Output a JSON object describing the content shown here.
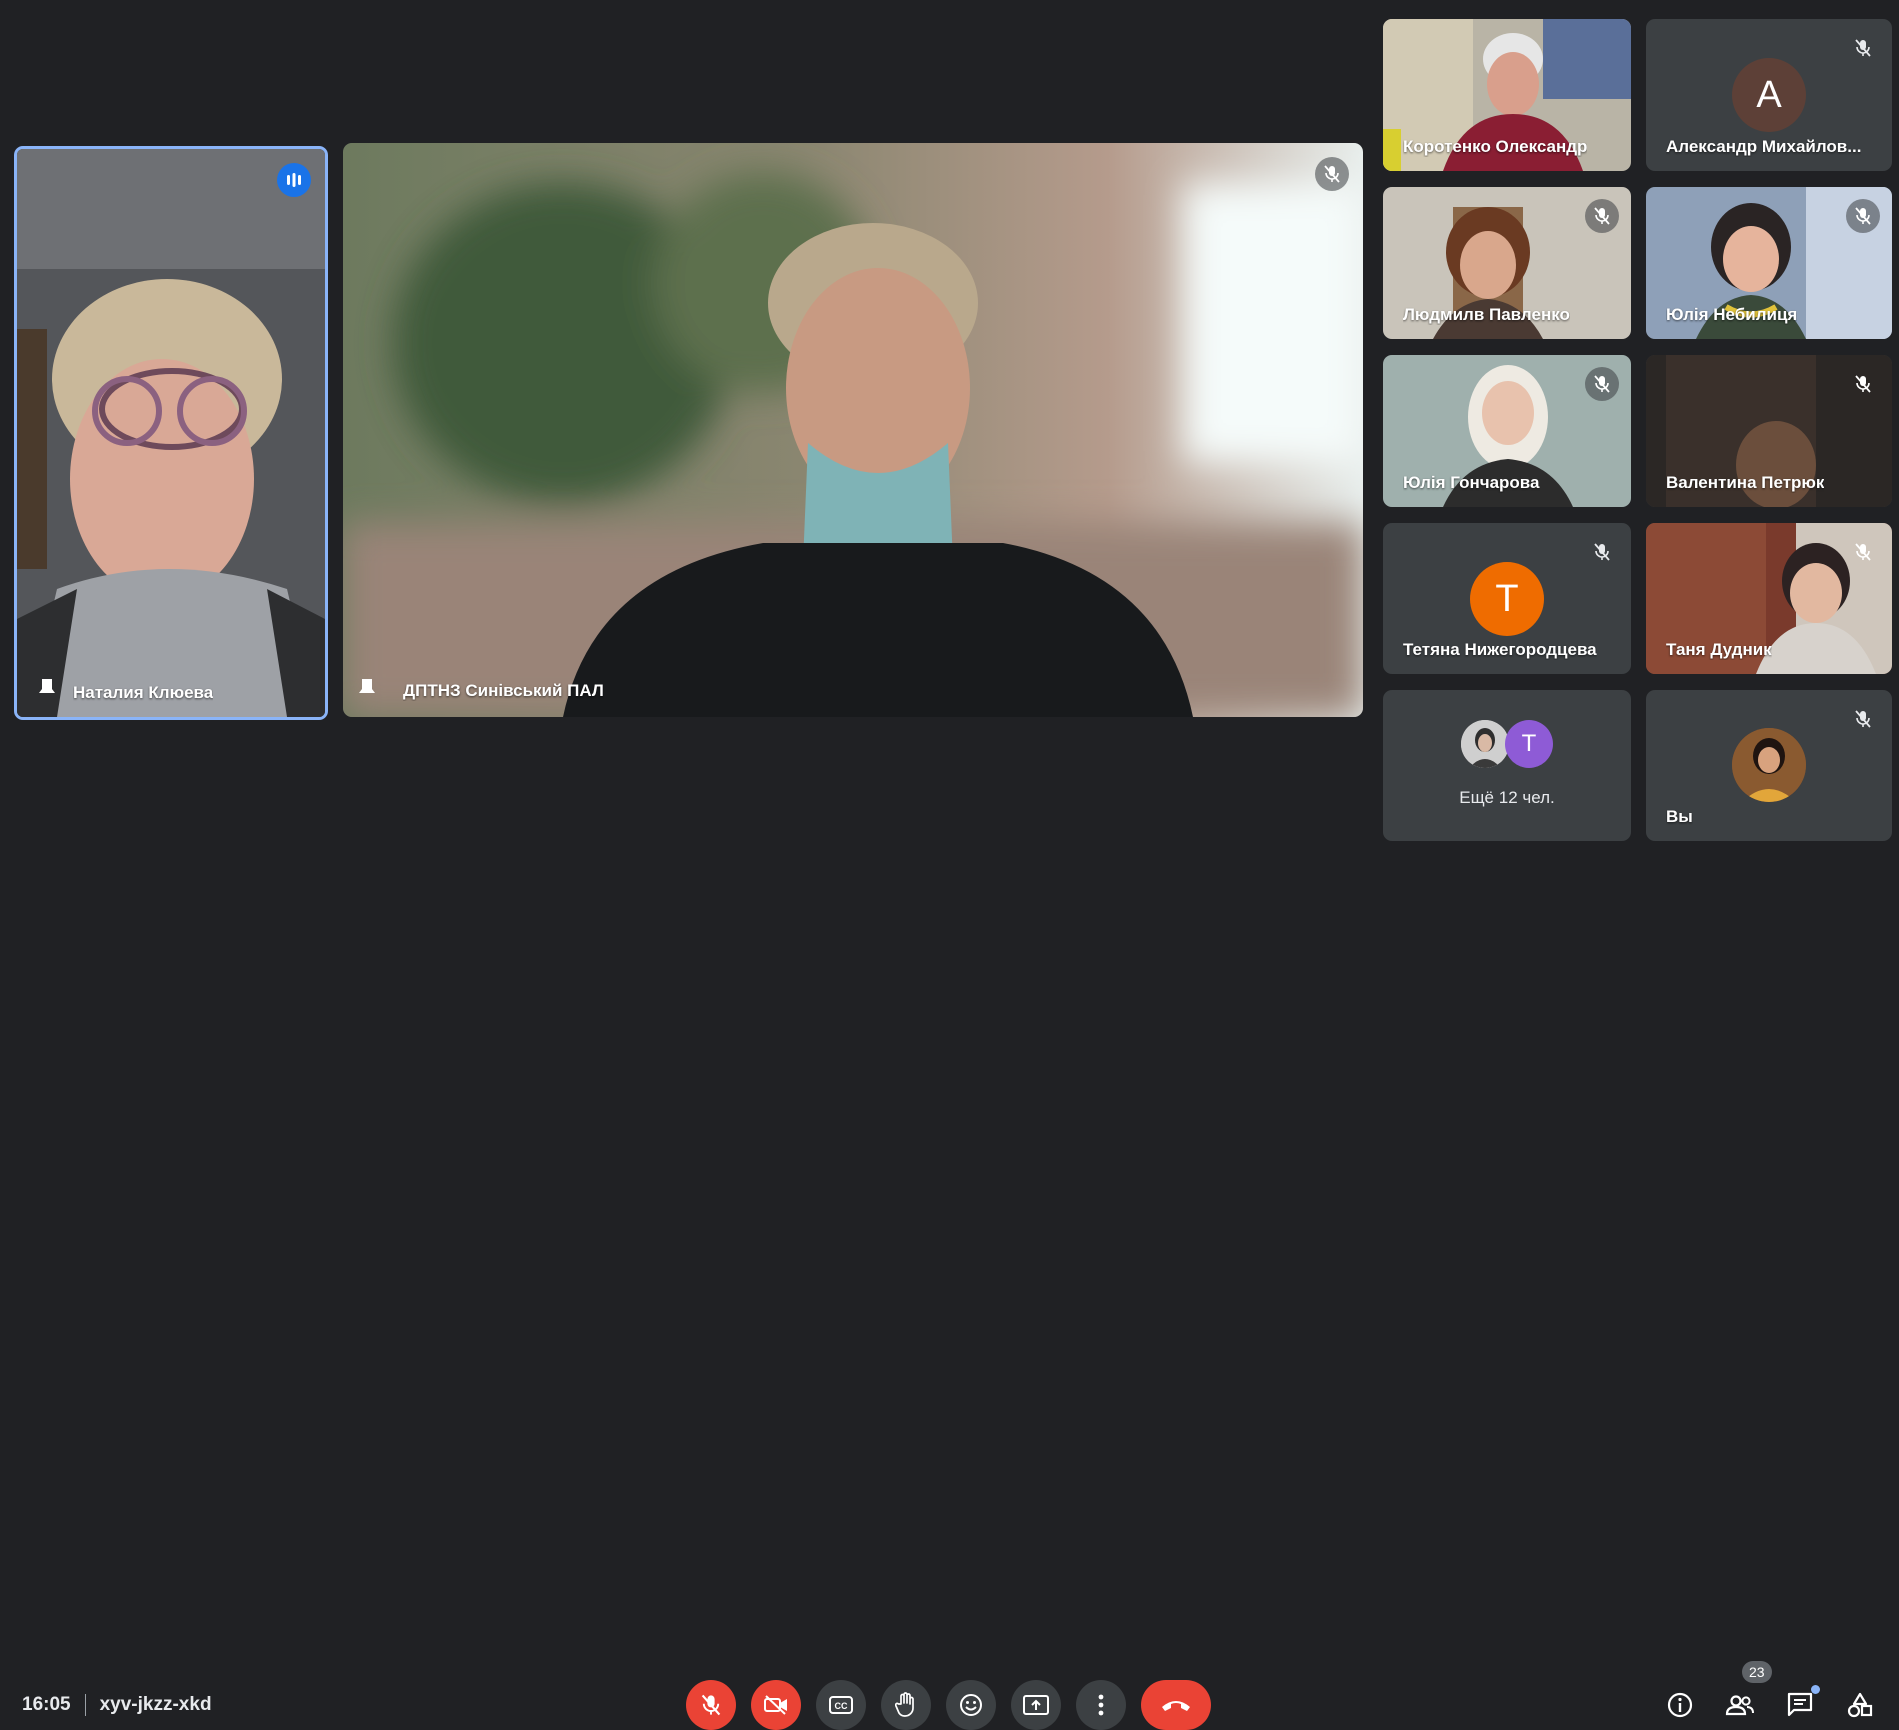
{
  "meeting": {
    "time": "16:05",
    "code": "xyv-jkzz-xkd",
    "participant_count": "23"
  },
  "pinned": [
    {
      "name": "Наталия Клюева",
      "speaking": true
    },
    {
      "name": "ДПТНЗ Синівський ПАЛ",
      "muted": true
    }
  ],
  "grid": [
    {
      "name": "Коротенко Олександр",
      "muted": false,
      "type": "video"
    },
    {
      "name": "Александр Михайлов...",
      "muted": true,
      "type": "avatar",
      "initial": "А",
      "avatar_color": "#5d4037"
    },
    {
      "name": "Людмилв Павленко",
      "muted": true,
      "type": "video"
    },
    {
      "name": "Юлія Небилиця",
      "muted": true,
      "type": "video"
    },
    {
      "name": "Юлія Гончарова",
      "muted": true,
      "type": "video"
    },
    {
      "name": "Валентина Петрюк",
      "muted": true,
      "type": "video"
    },
    {
      "name": "Тетяна Нижегородцева",
      "muted": true,
      "type": "avatar",
      "initial": "Т",
      "avatar_color": "#ef6c00"
    },
    {
      "name": "Таня Дудник",
      "muted": true,
      "type": "video"
    }
  ],
  "more": {
    "label": "Ещё 12 чел.",
    "initial": "T",
    "avatar_color": "#8e5bd6"
  },
  "self": {
    "label": "Вы",
    "muted": true
  },
  "controls": [
    {
      "name": "microphone",
      "state": "off",
      "color": "#ea4335"
    },
    {
      "name": "camera",
      "state": "off",
      "color": "#ea4335"
    },
    {
      "name": "captions"
    },
    {
      "name": "raise-hand"
    },
    {
      "name": "reactions"
    },
    {
      "name": "present"
    },
    {
      "name": "more-options"
    },
    {
      "name": "leave-call",
      "color": "#ea4335"
    }
  ],
  "colors": {
    "background": "#202124",
    "tile": "#3c4043",
    "accent": "#1a73e8",
    "danger": "#ea4335",
    "badge": "#5f6368"
  }
}
